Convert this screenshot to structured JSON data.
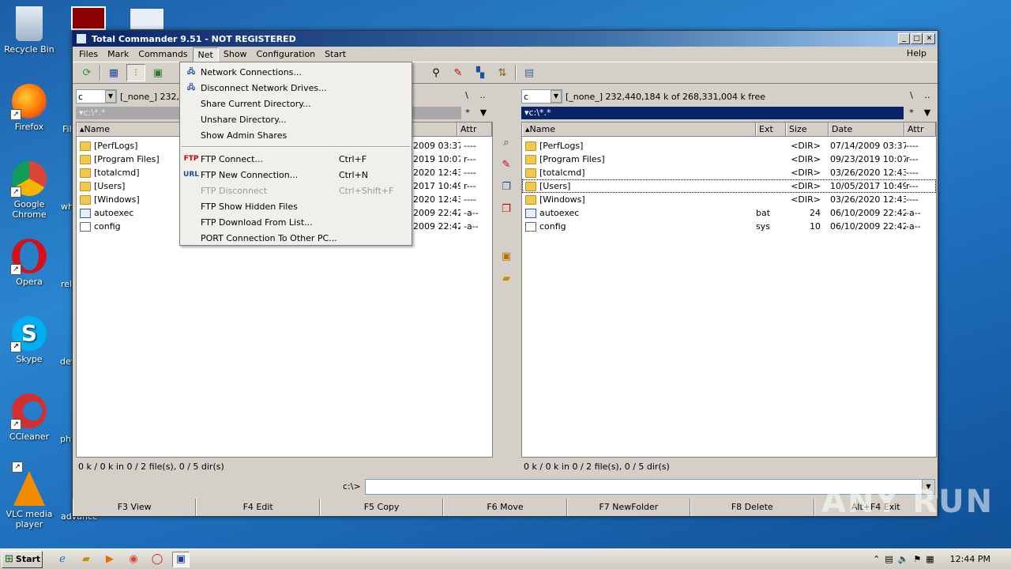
{
  "desktop": {
    "icons": [
      {
        "label": "Recycle Bin"
      },
      {
        "label": "Firefox"
      },
      {
        "label": "Google Chrome"
      },
      {
        "label": "Opera"
      },
      {
        "label": "Skype"
      },
      {
        "label": "CCleaner"
      },
      {
        "label": "VLC media player"
      }
    ],
    "partial_labels": [
      "Fil",
      "wh",
      "rel",
      "dev",
      "phy",
      "advance"
    ]
  },
  "window": {
    "title": "Total Commander 9.51 - NOT REGISTERED",
    "menubar": [
      "Files",
      "Mark",
      "Commands",
      "Net",
      "Show",
      "Configuration",
      "Start"
    ],
    "help": "Help"
  },
  "net_menu": {
    "items": [
      {
        "label": "Network Connections...",
        "shortcut": "",
        "disabled": false
      },
      {
        "label": "Disconnect Network Drives...",
        "shortcut": "",
        "disabled": false
      },
      {
        "label": "Share Current Directory...",
        "shortcut": "",
        "disabled": false
      },
      {
        "label": "Unshare Directory...",
        "shortcut": "",
        "disabled": false
      },
      {
        "label": "Show Admin Shares",
        "shortcut": "",
        "disabled": false
      },
      {
        "label": "FTP Connect...",
        "shortcut": "Ctrl+F",
        "disabled": false
      },
      {
        "label": "FTP New Connection...",
        "shortcut": "Ctrl+N",
        "disabled": false
      },
      {
        "label": "FTP Disconnect",
        "shortcut": "Ctrl+Shift+F",
        "disabled": true
      },
      {
        "label": "FTP Show Hidden Files",
        "shortcut": "",
        "disabled": false
      },
      {
        "label": "FTP Download From List...",
        "shortcut": "",
        "disabled": false
      },
      {
        "label": "PORT Connection To Other PC...",
        "shortcut": "",
        "disabled": false
      }
    ]
  },
  "left_panel": {
    "drive": "c",
    "drive_info": "[_none_]  232,4",
    "path": "c:\\*.*",
    "root_btn": "\\",
    "up_btn": "..",
    "star_btn": "*",
    "col_name": "Name",
    "col_attr": "Attr",
    "rows": [
      {
        "name": "[PerfLogs]",
        "date": "2009 03:37",
        "attr": "----"
      },
      {
        "name": "[Program Files]",
        "date": "2019 10:07",
        "attr": "r---"
      },
      {
        "name": "[totalcmd]",
        "date": "2020 12:43",
        "attr": "----"
      },
      {
        "name": "[Users]",
        "date": "2017 10:49",
        "attr": "r---"
      },
      {
        "name": "[Windows]",
        "date": "2020 12:43",
        "attr": "----"
      },
      {
        "name": "autoexec",
        "date": "2009 22:42",
        "attr": "-a--"
      },
      {
        "name": "config",
        "date": "2009 22:42",
        "attr": "-a--"
      }
    ],
    "status": "0 k / 0 k in 0 / 2 file(s), 0 / 5 dir(s)"
  },
  "right_panel": {
    "drive": "c",
    "drive_info": "[_none_]  232,440,184 k of 268,331,004 k free",
    "path": "c:\\*.*",
    "root_btn": "\\",
    "up_btn": "..",
    "star_btn": "*",
    "col_name": "Name",
    "col_ext": "Ext",
    "col_size": "Size",
    "col_date": "Date",
    "col_attr": "Attr",
    "rows": [
      {
        "name": "[PerfLogs]",
        "ext": "",
        "size": "<DIR>",
        "date": "07/14/2009 03:37",
        "attr": "----"
      },
      {
        "name": "[Program Files]",
        "ext": "",
        "size": "<DIR>",
        "date": "09/23/2019 10:07",
        "attr": "r---"
      },
      {
        "name": "[totalcmd]",
        "ext": "",
        "size": "<DIR>",
        "date": "03/26/2020 12:43",
        "attr": "----"
      },
      {
        "name": "[Users]",
        "ext": "",
        "size": "<DIR>",
        "date": "10/05/2017 10:49",
        "attr": "r---"
      },
      {
        "name": "[Windows]",
        "ext": "",
        "size": "<DIR>",
        "date": "03/26/2020 12:43",
        "attr": "----"
      },
      {
        "name": "autoexec",
        "ext": "bat",
        "size": "24",
        "date": "06/10/2009 22:42",
        "attr": "-a--"
      },
      {
        "name": "config",
        "ext": "sys",
        "size": "10",
        "date": "06/10/2009 22:42",
        "attr": "-a--"
      }
    ],
    "status": "0 k / 0 k in 0 / 2 file(s), 0 / 5 dir(s)"
  },
  "cmdline": {
    "prompt": "c:\\>"
  },
  "fkeys": [
    "F3 View",
    "F4 Edit",
    "F5 Copy",
    "F6 Move",
    "F7 NewFolder",
    "F8 Delete",
    "Alt+F4 Exit"
  ],
  "taskbar": {
    "start": "Start",
    "clock": "12:44 PM"
  },
  "watermark": "ANY RUN"
}
